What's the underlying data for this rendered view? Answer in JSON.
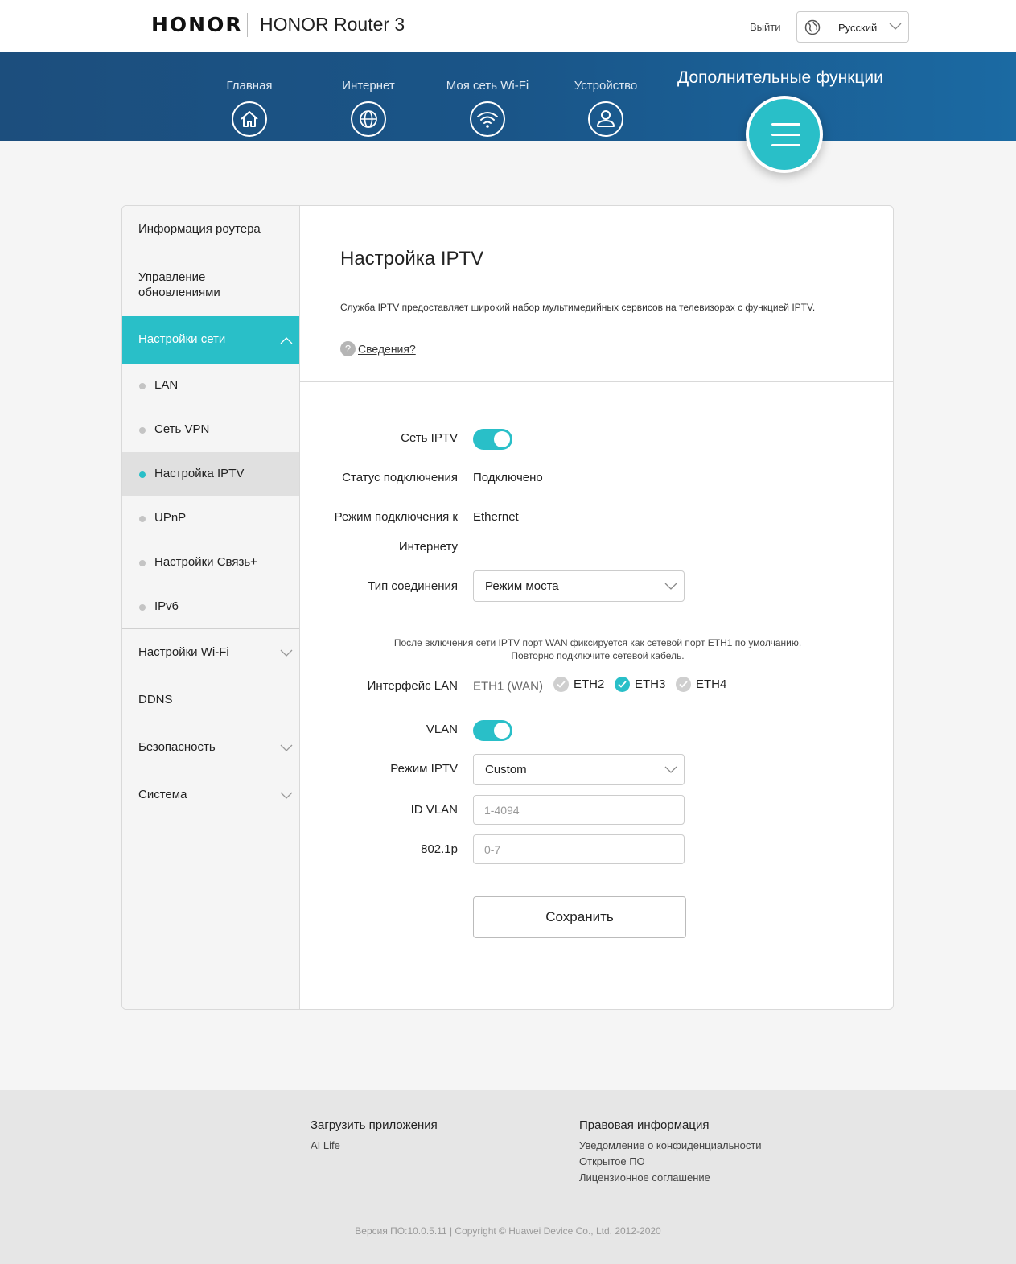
{
  "header": {
    "brand": "HONOR",
    "product": "HONOR Router 3",
    "logout": "Выйти",
    "language": "Русский"
  },
  "nav": {
    "items": [
      {
        "label": "Главная",
        "icon": "home-icon"
      },
      {
        "label": "Интернет",
        "icon": "globe-icon"
      },
      {
        "label": "Моя сеть Wi-Fi",
        "icon": "wifi-icon"
      },
      {
        "label": "Устройство",
        "icon": "user-icon"
      }
    ],
    "active_label": "Дополнительные функции",
    "active_icon": "menu-icon"
  },
  "sidebar": {
    "router_info": "Информация роутера",
    "update_mgmt": "Управление обновлениями",
    "network_settings": "Настройки сети",
    "sub_items": [
      {
        "label": "LAN",
        "active": false
      },
      {
        "label": "Сеть VPN",
        "active": false
      },
      {
        "label": "Настройка IPTV",
        "active": true
      },
      {
        "label": "UPnP",
        "active": false
      },
      {
        "label": "Настройки Связь+",
        "active": false
      },
      {
        "label": "IPv6",
        "active": false
      }
    ],
    "wifi_settings": "Настройки Wi-Fi",
    "ddns": "DDNS",
    "security": "Безопасность",
    "system": "Система"
  },
  "page": {
    "title": "Настройка IPTV",
    "description": "Служба IPTV предоставляет широкий набор мультимедийных сервисов на телевизорах с функцией IPTV.",
    "help_link": "Сведения?"
  },
  "form": {
    "iptv_label": "Сеть IPTV",
    "iptv_enabled": true,
    "status_label": "Статус подключения",
    "status_value": "Подключено",
    "mode_label_line1": "Режим подключения к",
    "mode_label_line2": "Интернету",
    "mode_value": "Ethernet",
    "conn_type_label": "Тип соединения",
    "conn_type_value": "Режим моста",
    "note_line1": "После включения сети IPTV порт WAN фиксируется как сетевой порт ETH1 по умолчанию.",
    "note_line2": "Повторно подключите сетевой кабель.",
    "lan_label": "Интерфейс LAN",
    "ports": [
      {
        "label": "ETH1 (WAN)",
        "checked": null
      },
      {
        "label": "ETH2",
        "checked": false
      },
      {
        "label": "ETH3",
        "checked": true
      },
      {
        "label": "ETH4",
        "checked": false
      }
    ],
    "vlan_label": "VLAN",
    "vlan_enabled": true,
    "iptv_mode_label": "Режим IPTV",
    "iptv_mode_value": "Custom",
    "vlan_id_label": "ID VLAN",
    "vlan_id_placeholder": "1-4094",
    "dot1p_label": "802.1p",
    "dot1p_placeholder": "0-7",
    "save_label": "Сохранить"
  },
  "footer": {
    "apps_title": "Загрузить приложения",
    "apps_link": "AI Life",
    "legal_title": "Правовая информация",
    "legal_links": [
      "Уведомление о конфиденциальности",
      "Открытое ПО",
      "Лицензионное соглашение"
    ],
    "copyright": "Версия ПО:10.0.5.11 |  Copyright © Huawei Device Co., Ltd. 2012-2020"
  },
  "colors": {
    "accent": "#29bfc8",
    "nav_band": "#1a5588"
  }
}
